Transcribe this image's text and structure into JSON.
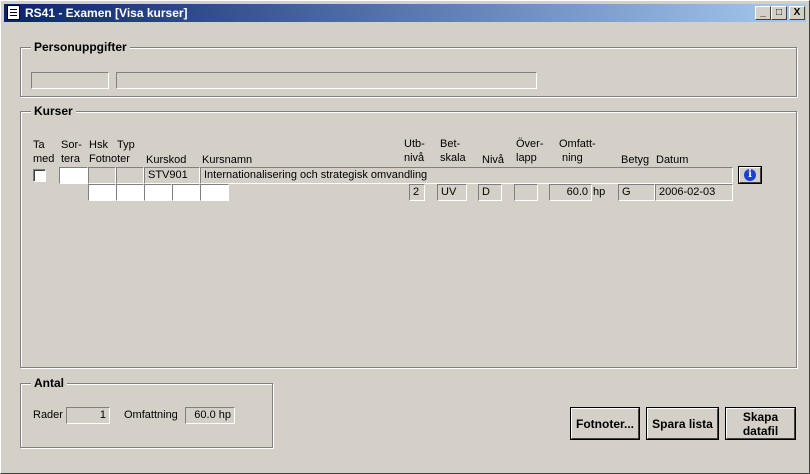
{
  "window": {
    "title": "RS41 - Examen [Visa kurser]",
    "controls": {
      "minimize": "_",
      "maximize": "□",
      "close": "X"
    }
  },
  "personuppgifter": {
    "legend": "Personuppgifter",
    "personnummer": "",
    "namn": ""
  },
  "kurser": {
    "legend": "Kurser",
    "headers": {
      "ta_med": [
        "Ta",
        "med"
      ],
      "sortera": [
        "Sor-",
        "tera"
      ],
      "hsk": "Hsk",
      "typ": "Typ",
      "fotnoter": "Fotnoter",
      "kurskod": "Kurskod",
      "kursnamn": "Kursnamn",
      "utbniva": [
        "Utb-",
        "nivå"
      ],
      "betskala": [
        "Bet-",
        "skala"
      ],
      "niva": "Nivå",
      "overlapp": [
        "Över-",
        "lapp"
      ],
      "omfattning": [
        "Omfatt-",
        "ning"
      ],
      "betyg": "Betyg",
      "datum": "Datum"
    },
    "rows": [
      {
        "ta_med": false,
        "sortera": "",
        "hsk": "",
        "typ": "",
        "kurskod": "STV901",
        "kursnamn": "Internationalisering och strategisk omvandling",
        "fotnoter": [
          "",
          "",
          "",
          "",
          ""
        ],
        "utbniva": "2",
        "betskala": "UV",
        "niva": "D",
        "overlapp": "",
        "omfattning": "60.0",
        "enhet": "hp",
        "betyg": "G",
        "datum": "2006-02-03",
        "info_icon": "info-icon"
      }
    ]
  },
  "antal": {
    "legend": "Antal",
    "rader_label": "Rader",
    "rader_value": "1",
    "omfattning_label": "Omfattning",
    "omfattning_value": "60.0 hp"
  },
  "buttons": {
    "fotnoter": "Fotnoter...",
    "spara_lista": "Spara lista",
    "skapa_datafil": [
      "Skapa",
      "datafil"
    ]
  }
}
